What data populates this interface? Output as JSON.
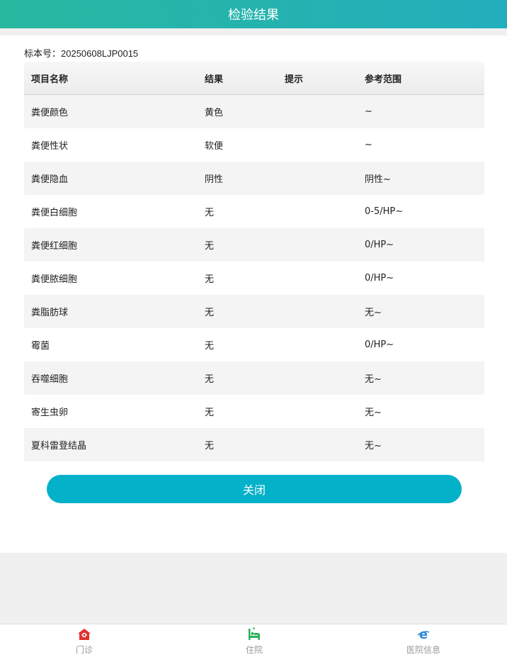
{
  "header": {
    "title": "检验结果"
  },
  "specimen": {
    "text": "标本号：20250608LJP0015"
  },
  "table": {
    "headers": [
      "项目名称",
      "结果",
      "提示",
      "参考范围"
    ],
    "rows": [
      {
        "name": "粪便颜色",
        "result": "黄色",
        "hint": "",
        "range": "~"
      },
      {
        "name": "粪便性状",
        "result": "软便",
        "hint": "",
        "range": "~"
      },
      {
        "name": "粪便隐血",
        "result": "阴性",
        "hint": "",
        "range": "阴性~"
      },
      {
        "name": "粪便白细胞",
        "result": "无",
        "hint": "",
        "range": "0-5/HP~"
      },
      {
        "name": "粪便红细胞",
        "result": "无",
        "hint": "",
        "range": "0/HP~"
      },
      {
        "name": "粪便脓细胞",
        "result": "无",
        "hint": "",
        "range": "0/HP~"
      },
      {
        "name": "粪脂肪球",
        "result": "无",
        "hint": "",
        "range": "无~"
      },
      {
        "name": "霉菌",
        "result": "无",
        "hint": "",
        "range": "0/HP~"
      },
      {
        "name": "吞噬细胞",
        "result": "无",
        "hint": "",
        "range": "无~"
      },
      {
        "name": "寄生虫卵",
        "result": "无",
        "hint": "",
        "range": "无~"
      },
      {
        "name": "夏科雷登结晶",
        "result": "无",
        "hint": "",
        "range": "无~"
      }
    ]
  },
  "buttons": {
    "close": "关闭"
  },
  "tabbar": {
    "items": [
      {
        "label": "门诊",
        "icon": "outpatient-house-icon",
        "color": "#e0322c"
      },
      {
        "label": "住院",
        "icon": "hospital-bed-icon",
        "color": "#2bb05a"
      },
      {
        "label": "医院信息",
        "icon": "browser-e-icon",
        "color": "#2a8bd8"
      }
    ]
  },
  "colors": {
    "header_start": "#28b8a0",
    "header_end": "#22aebc",
    "button": "#03b1c9"
  }
}
